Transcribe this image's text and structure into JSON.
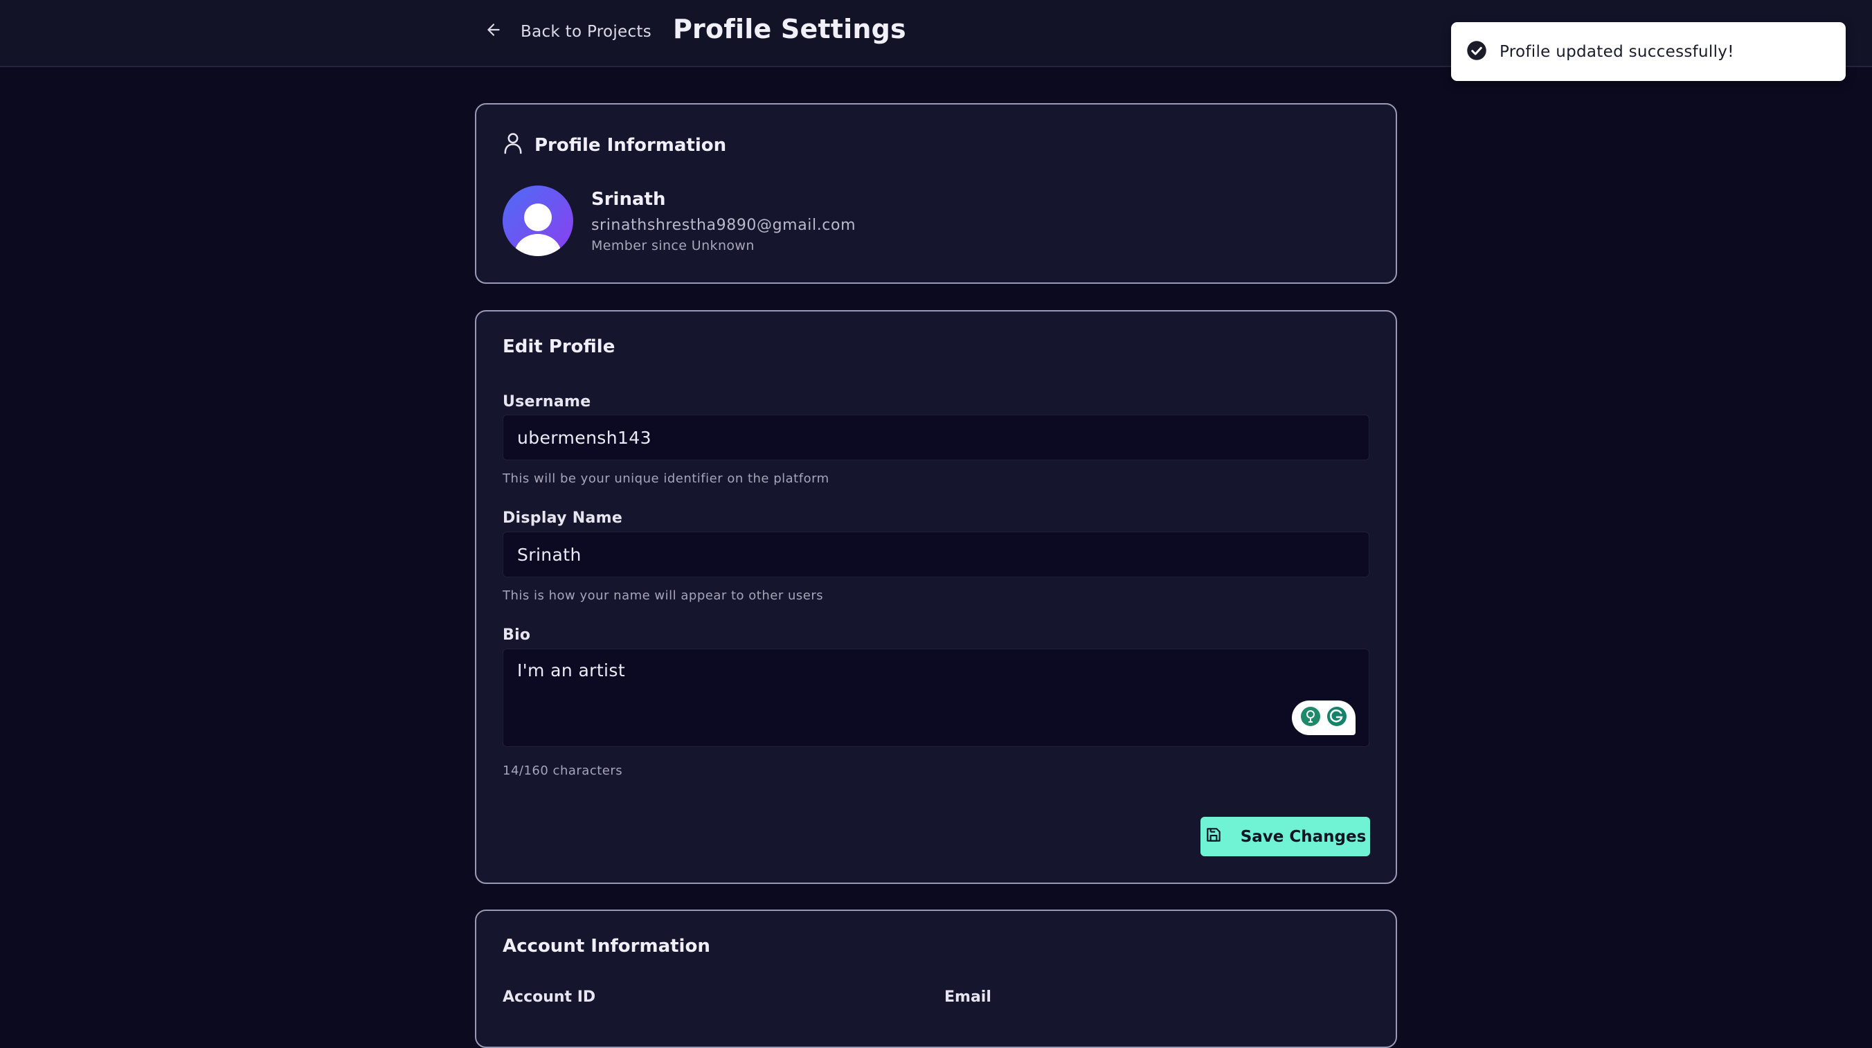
{
  "header": {
    "back_label": "Back to Projects",
    "title": "Profile Settings"
  },
  "toast": {
    "message": "Profile updated successfully!"
  },
  "profile_info": {
    "heading": "Profile Information",
    "name": "Srinath",
    "email": "srinathshrestha9890@gmail.com",
    "member_since": "Member since Unknown"
  },
  "edit_profile": {
    "heading": "Edit Profile",
    "username": {
      "label": "Username",
      "value": "ubermensh143",
      "hint": "This will be your unique identifier on the platform"
    },
    "display_name": {
      "label": "Display Name",
      "value": "Srinath",
      "hint": "This is how your name will appear to other users"
    },
    "bio": {
      "label": "Bio",
      "value": "I'm an artist",
      "char_count": "14/160 characters"
    },
    "save_label": "Save Changes"
  },
  "account_info": {
    "heading": "Account Information",
    "field_1_label": "Account ID",
    "field_2_label": "Email"
  },
  "colors": {
    "background": "#0b0a1f",
    "card": "#15152e",
    "accent": "#6ff3d4",
    "avatar_gradient_start": "#4e6cf5",
    "avatar_gradient_end": "#8b3ff0"
  }
}
